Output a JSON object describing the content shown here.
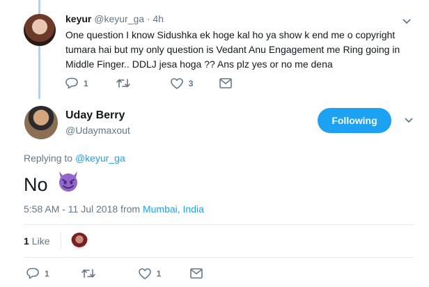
{
  "reply": {
    "name": "keyur",
    "handle": "@keyur_ga",
    "separator": "·",
    "time": "4h",
    "text": "One question I know Sidushka ek hoge kal ho ya show k end me o copyright tumara hai but my only question is Vedant Anu Engagement me Ring going in Middle Finger.. DDLJ  jesa hoga ?? Ans plz yes or no me dena",
    "reply_count": "1",
    "retweet_count": "",
    "like_count": "3"
  },
  "tweet": {
    "name": "Uday Berry",
    "handle": "@Udaymaxout",
    "follow_label": "Following",
    "replying_prefix": "Replying to",
    "replying_to": "@keyur_ga",
    "text": "No",
    "emoji_icon": "smiling-imp-icon",
    "timestamp": "5:58 AM - 11 Jul 2018 from",
    "location": "Mumbai, India",
    "likes_count": "1",
    "likes_label": "Like",
    "reply_count": "1",
    "retweet_count": "",
    "like_count": "1"
  },
  "colors": {
    "accent": "#1da1f2",
    "muted": "#657786",
    "thread_line": "#a5d4ff",
    "emoji": "#9266cc"
  }
}
